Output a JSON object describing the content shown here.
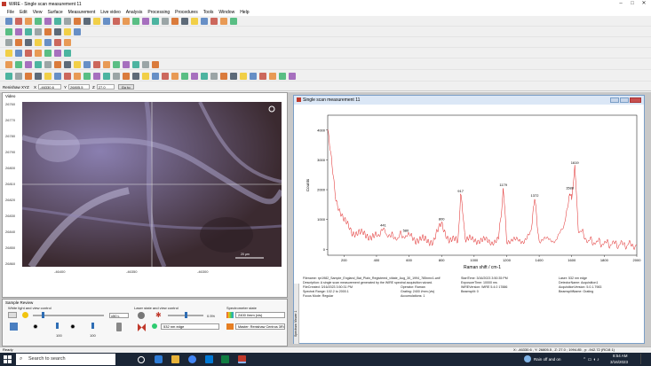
{
  "app": {
    "title": "WiRE - Single scan measurement 11",
    "status": "Ready",
    "coords": "X: -46330.6 , Y: 26805.5 , Z: 27.0 ; 1994.85 , y: -942.72 (RC/8 1)"
  },
  "window_controls": {
    "minimize": "–",
    "maximize": "□",
    "close": "✕"
  },
  "menu": [
    "File",
    "Edit",
    "View",
    "Surface",
    "Measurement",
    "Live video",
    "Analysis",
    "Processing",
    "Procedures",
    "Tools",
    "Window",
    "Help"
  ],
  "positionbar": {
    "label": "Renishaw XYZ",
    "x_label": "X",
    "x_value": "-46330.6",
    "y_label": "Y",
    "y_value": "26805.5",
    "z_label": "Z",
    "z_value": "27.0",
    "go_button": "Go to"
  },
  "video": {
    "title": "Video",
    "yticks": [
      "26760",
      "26770",
      "26780",
      "26790",
      "26800",
      "26810",
      "26820",
      "26830",
      "26840",
      "26850",
      "26860"
    ],
    "xticks": [
      "-46400",
      "-46350",
      "-46300"
    ],
    "scale_bar": "20 μm"
  },
  "sample_review": {
    "title": "Sample Review",
    "white_light": "White light and view control",
    "laser": "Laser state and view control",
    "spectrometer": "Spectrometer state",
    "zoom": "x50 L",
    "val100a": "100",
    "val100b": "100",
    "laser_power": "0.5%",
    "laser_line": "532 nm edge",
    "grating": "2400 l/mm (vis)",
    "master": "Master: Renishaw Centrus 3RV"
  },
  "spectrum": {
    "title": "Single scan measurement 11",
    "ylabel": "Counts",
    "xlabel": "Raman shift / cm-1",
    "side_label": "Spectrum Viewer 1",
    "yticks": [
      "0",
      "1000",
      "2000",
      "3000",
      "4000"
    ],
    "xticks": [
      "200",
      "400",
      "600",
      "800",
      "1000",
      "1200",
      "1400",
      "1600",
      "1800",
      "2000"
    ],
    "peaks": [
      {
        "x": 441,
        "label": "441"
      },
      {
        "x": 580,
        "label": "580"
      },
      {
        "x": 800,
        "label": "800"
      },
      {
        "x": 917,
        "label": "917"
      },
      {
        "x": 1179,
        "label": "1179"
      },
      {
        "x": 1372,
        "label": "1372"
      },
      {
        "x": 1588,
        "label": "1588"
      },
      {
        "x": 1619,
        "label": "1619"
      }
    ],
    "meta": [
      "Filename: rpr1982_Sample_England_Bat_Plain_Registered_vitiate_Aug_30_1994_785nmv1.wdf",
      "Description: A single scan measurement generated by the WiRE spectral acquisition wizard.",
      "FileCreated: 3/16/2023 3:50:31 PM",
      "Spectral Range: 102.2 to 2000.1",
      "Focus Mode: Regular",
      "Operator: Raman",
      "Grating: 2400 l/mm (vis)",
      "Accumulations: 1",
      "StartTime: 3/16/2023 3:50:35 PM",
      "ExposureTime: 10000 ms",
      "WiREVersion: WiRE 5.4.0 17886",
      "Beamsplit: 0",
      "Laser: 532 nm edge",
      "DetectorName: Acquisition1",
      "AcquisitionVersion: 5.0.1.7983",
      "BeamsplitName: Grating"
    ]
  },
  "chart_data": {
    "type": "line",
    "title": "",
    "xlabel": "Raman shift / cm-1",
    "ylabel": "Counts",
    "xlim": [
      100,
      2000
    ],
    "ylim": [
      -200,
      4500
    ],
    "x": [
      100,
      150,
      200,
      250,
      300,
      350,
      400,
      441,
      500,
      580,
      650,
      700,
      750,
      800,
      850,
      900,
      917,
      950,
      1000,
      1050,
      1100,
      1150,
      1179,
      1200,
      1250,
      1300,
      1350,
      1372,
      1400,
      1450,
      1500,
      1550,
      1588,
      1600,
      1619,
      1640,
      1700,
      1800,
      1900,
      2000
    ],
    "y": [
      4000,
      1700,
      950,
      600,
      520,
      470,
      420,
      650,
      380,
      470,
      330,
      300,
      290,
      850,
      290,
      280,
      1800,
      280,
      350,
      280,
      270,
      310,
      2000,
      330,
      270,
      310,
      500,
      1650,
      320,
      300,
      340,
      650,
      1900,
      1700,
      2750,
      700,
      280,
      200,
      170,
      130
    ]
  },
  "taskbar": {
    "search": "Search to search",
    "weather": "Rain off and on",
    "time": "8:54 AM",
    "date": "3/16/2023"
  }
}
